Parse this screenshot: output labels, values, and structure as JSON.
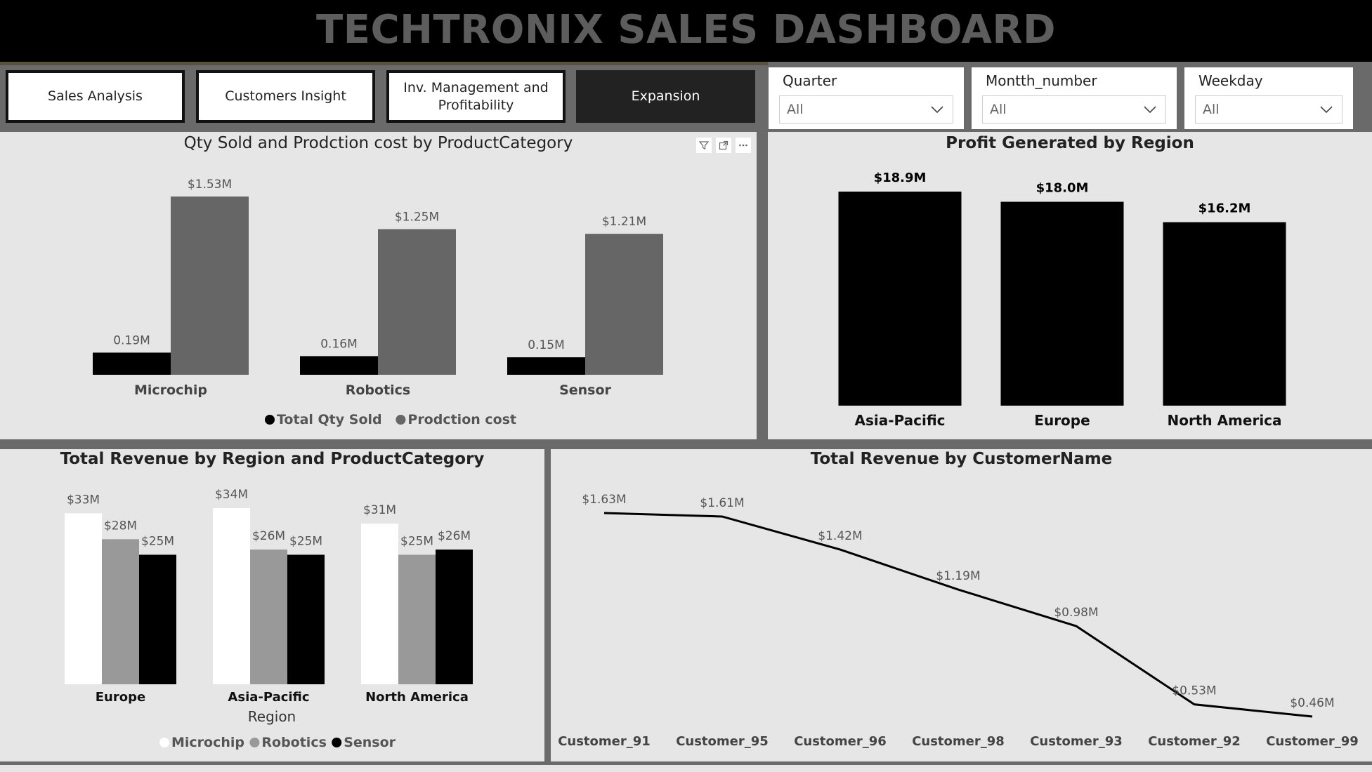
{
  "header": {
    "title": "TECHTRONIX SALES DASHBOARD"
  },
  "nav": {
    "sales": "Sales Analysis",
    "customers": "Customers Insight",
    "inventory": "Inv. Management and Profitability",
    "expansion": "Expansion"
  },
  "slicers": {
    "quarter": {
      "label": "Quarter",
      "value": "All"
    },
    "month": {
      "label": "Montth_number",
      "value": "All"
    },
    "weekday": {
      "label": "Weekday",
      "value": "All"
    }
  },
  "visual_icons": [
    "filter-icon",
    "focus-mode-icon",
    "more-options-icon"
  ],
  "colors": {
    "black": "#000000",
    "darkgray": "#666666",
    "midgray": "#999999",
    "white": "#ffffff",
    "panel": "#e6e6e6"
  },
  "chart_data": [
    {
      "id": "qty_cost",
      "type": "bar",
      "title": "Qty Sold and Prodction cost by ProductCategory",
      "categories": [
        "Microchip",
        "Robotics",
        "Sensor"
      ],
      "series": [
        {
          "name": "Total Qty Sold",
          "values": [
            0.19,
            0.16,
            0.15
          ],
          "labels": [
            "0.19M",
            "0.16M",
            "0.15M"
          ],
          "color": "#000000"
        },
        {
          "name": "Prodction cost",
          "values": [
            1.53,
            1.25,
            1.21
          ],
          "labels": [
            "$1.53M",
            "$1.25M",
            "$1.21M"
          ],
          "color": "#666666"
        }
      ],
      "legend": "bottom",
      "ylim": [
        0,
        1.53
      ]
    },
    {
      "id": "profit_region",
      "type": "bar",
      "title": "Profit Generated by Region",
      "categories": [
        "Asia-Pacific",
        "Europe",
        "North America"
      ],
      "values": [
        18.9,
        18.0,
        16.2
      ],
      "labels": [
        "$18.9M",
        "$18.0M",
        "$16.2M"
      ],
      "color": "#000000",
      "ylim": [
        0,
        18.9
      ]
    },
    {
      "id": "rev_region_cat",
      "type": "bar",
      "title": "Total Revenue by Region and ProductCategory",
      "xlabel": "Region",
      "categories": [
        "Europe",
        "Asia-Pacific",
        "North America"
      ],
      "series": [
        {
          "name": "Microchip",
          "values": [
            33,
            34,
            31
          ],
          "labels": [
            "$33M",
            "$34M",
            "$31M"
          ],
          "color": "#ffffff"
        },
        {
          "name": "Robotics",
          "values": [
            28,
            26,
            25
          ],
          "labels": [
            "$28M",
            "$26M",
            "$25M"
          ],
          "color": "#999999"
        },
        {
          "name": "Sensor",
          "values": [
            25,
            25,
            26
          ],
          "labels": [
            "$25M",
            "$25M",
            "$26M"
          ],
          "color": "#000000"
        }
      ],
      "legend": "bottom",
      "ylim": [
        0,
        34
      ]
    },
    {
      "id": "rev_customer",
      "type": "line",
      "title": "Total Revenue by CustomerName",
      "categories": [
        "Customer_91",
        "Customer_95",
        "Customer_96",
        "Customer_98",
        "Customer_93",
        "Customer_92",
        "Customer_99"
      ],
      "values": [
        1.63,
        1.61,
        1.42,
        1.19,
        0.98,
        0.53,
        0.46
      ],
      "labels": [
        "$1.63M",
        "$1.61M",
        "$1.42M",
        "$1.19M",
        "$0.98M",
        "$0.53M",
        "$0.46M"
      ],
      "color": "#000000",
      "ylim": [
        0.46,
        1.63
      ]
    }
  ]
}
